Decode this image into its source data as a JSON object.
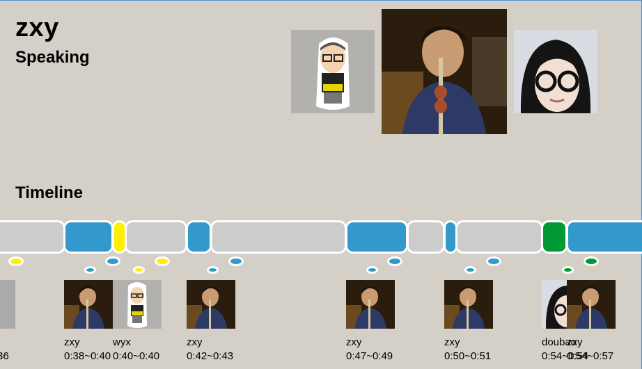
{
  "speaker": {
    "name": "zxy",
    "status": "Speaking"
  },
  "timeline_title": "Timeline",
  "colors": {
    "idle": "#cccccc",
    "zxy": "#3399cc",
    "wyx": "#ffee00",
    "doubao": "#009933"
  },
  "participants": [
    {
      "id": "wyx",
      "icon": "cartoon-avatar"
    },
    {
      "id": "zxy",
      "icon": "photo-avatar"
    },
    {
      "id": "doubao",
      "icon": "photo-avatar"
    }
  ],
  "clips": [
    {
      "name": "",
      "time": "36"
    },
    {
      "name": "zxy",
      "time": "0:38~0:40"
    },
    {
      "name": "wyx",
      "time": "0:40~0:40"
    },
    {
      "name": "zxy",
      "time": "0:42~0:43"
    },
    {
      "name": "zxy",
      "time": "0:47~0:49"
    },
    {
      "name": "zxy",
      "time": "0:50~0:51"
    },
    {
      "name": "doubao",
      "time": "0:54~0:54"
    },
    {
      "name": "zxy",
      "time": "0:54~0:57"
    }
  ]
}
